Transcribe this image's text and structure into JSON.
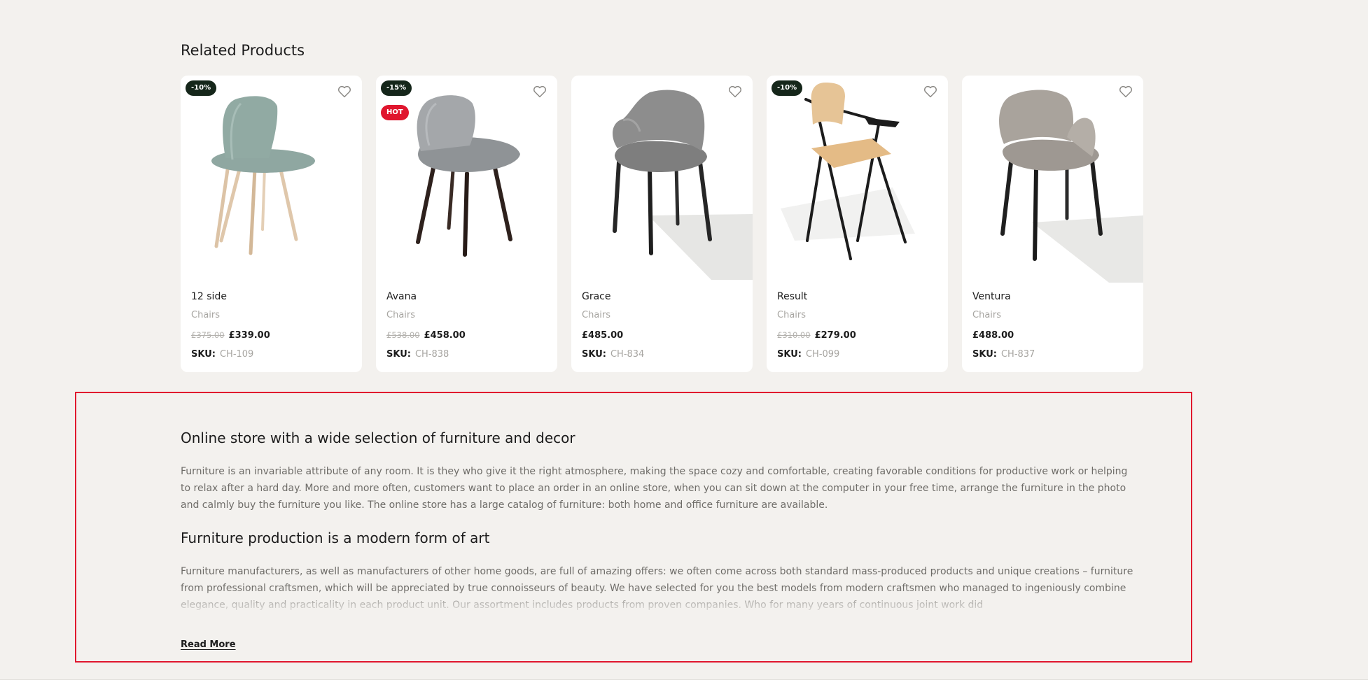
{
  "related": {
    "title": "Related Products",
    "products": [
      {
        "name": "12 side",
        "category": "Chairs",
        "old_price": "£375.00",
        "price": "£339.00",
        "sku_label": "SKU:",
        "sku": "CH-109",
        "badges": [
          "-10%"
        ]
      },
      {
        "name": "Avana",
        "category": "Chairs",
        "old_price": "£538.00",
        "price": "£458.00",
        "sku_label": "SKU:",
        "sku": "CH-838",
        "badges": [
          "-15%",
          "HOT"
        ]
      },
      {
        "name": "Grace",
        "category": "Chairs",
        "price": "£485.00",
        "sku_label": "SKU:",
        "sku": "CH-834",
        "badges": []
      },
      {
        "name": "Result",
        "category": "Chairs",
        "old_price": "£310.00",
        "price": "£279.00",
        "sku_label": "SKU:",
        "sku": "CH-099",
        "badges": [
          "-10%"
        ]
      },
      {
        "name": "Ventura",
        "category": "Chairs",
        "price": "£488.00",
        "sku_label": "SKU:",
        "sku": "CH-837",
        "badges": []
      }
    ]
  },
  "seo": {
    "heading1": "Online store with a wide selection of furniture and decor",
    "paragraph1": "Furniture is an invariable attribute of any room. It is they who give it the right atmosphere, making the space cozy and comfortable, creating favorable conditions for productive work or helping to relax after a hard day. More and more often, customers want to place an order in an online store, when you can sit down at the computer in your free time, arrange the furniture in the photo and calmly buy the furniture you like. The online store has a large catalog of furniture: both home and office furniture are available.",
    "heading2": "Furniture production is a modern form of art",
    "paragraph2": "Furniture manufacturers, as well as manufacturers of other home goods, are full of amazing offers: we often come across both standard mass-produced products and unique creations – furniture from professional craftsmen, which will be appreciated by true connoisseurs of beauty. We have selected for you the best models from modern craftsmen who managed to ingeniously combine elegance, quality and practicality in each product unit. Our assortment includes products from proven companies. Who for many years of continuous joint work did",
    "read_more": "Read More"
  },
  "colors": {
    "badge_sale": "#15261a",
    "badge_hot": "#e0162e",
    "highlight_border": "#e0162e"
  }
}
